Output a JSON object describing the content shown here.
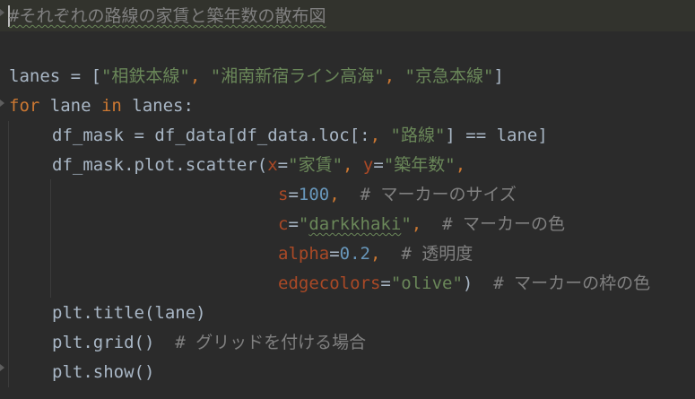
{
  "editor": {
    "lines": {
      "l0": {
        "comment": "#それぞれの路線の家賃と築年数の散布図"
      },
      "l2": {
        "name": "lanes",
        "assign": " = [",
        "s1": "\"相鉄本線\"",
        "sep1": ", ",
        "s2": "\"湘南新宿ライン高海\"",
        "sep2": ", ",
        "s3": "\"京急本線\"",
        "close": "]"
      },
      "l3": {
        "kw_for": "for",
        "var": " lane ",
        "kw_in": "in",
        "iter": " lanes:"
      },
      "l4": {
        "code1": "df_mask = df_data[df_data.loc[:",
        "comma": ",",
        "space": " ",
        "str": "\"路線\"",
        "code2": "] == lane]"
      },
      "l5": {
        "code1": "df_mask.plot.scatter(",
        "p_x": "x",
        "eq1": "=",
        "v_x": "\"家賃\"",
        "c1": ", ",
        "p_y": "y",
        "eq2": "=",
        "v_y": "\"築年数\"",
        "c2": ","
      },
      "l6": {
        "param": "s",
        "eq": "=",
        "value": "100",
        "comma": ",",
        "comment": "  # マーカーのサイズ"
      },
      "l7": {
        "param": "c",
        "eq": "=",
        "q1": "\"",
        "value": "darkkhaki",
        "q2": "\"",
        "comma": ",",
        "comment": "  # マーカーの色"
      },
      "l8": {
        "param": "alpha",
        "eq": "=",
        "value": "0.2",
        "comma": ",",
        "comment": "  # 透明度"
      },
      "l9": {
        "param": "edgecolors",
        "eq": "=",
        "value": "\"olive\"",
        "close": ")",
        "comment": "  # マーカーの枠の色"
      },
      "l10": {
        "code": "plt.title(lane)"
      },
      "l11": {
        "code": "plt.grid()",
        "comment": "  # グリッドを付ける場合"
      },
      "l12": {
        "code": "plt.show()"
      }
    }
  },
  "colors": {
    "background": "#2b2b2b",
    "current_line": "#32332d",
    "default_text": "#a9b7c6",
    "comment": "#808080",
    "keyword": "#cc7832",
    "string": "#6a8759",
    "number": "#6897bb",
    "parameter": "#aa4926"
  }
}
